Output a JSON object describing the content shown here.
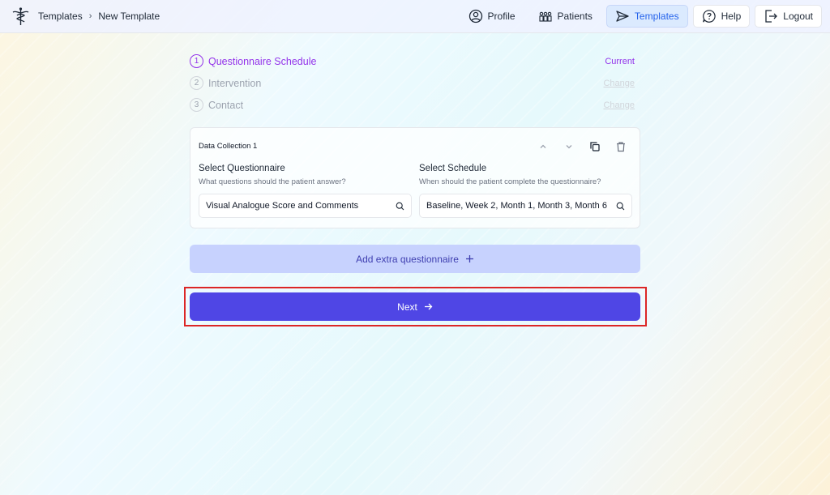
{
  "breadcrumb": {
    "root": "Templates",
    "separator": "›",
    "current": "New Template"
  },
  "nav": {
    "profile": "Profile",
    "patients": "Patients",
    "templates": "Templates",
    "help": "Help",
    "logout": "Logout"
  },
  "steps": [
    {
      "num": "1",
      "label": "Questionnaire Schedule",
      "status": "Current"
    },
    {
      "num": "2",
      "label": "Intervention",
      "status": "Change"
    },
    {
      "num": "3",
      "label": "Contact",
      "status": "Change"
    }
  ],
  "card": {
    "title": "Data Collection 1",
    "questionnaire": {
      "label": "Select Questionnaire",
      "help": "What questions should the patient answer?",
      "value": "Visual Analogue Score and Comments"
    },
    "schedule": {
      "label": "Select Schedule",
      "help": "When should the patient complete the questionnaire?",
      "value": "Baseline, Week 2, Month 1, Month 3, Month 6"
    }
  },
  "actions": {
    "add_label": "Add extra questionnaire",
    "next_label": "Next"
  },
  "colors": {
    "accent": "#4f46e5",
    "step_current": "#9333ea",
    "highlight": "#dc2626"
  }
}
